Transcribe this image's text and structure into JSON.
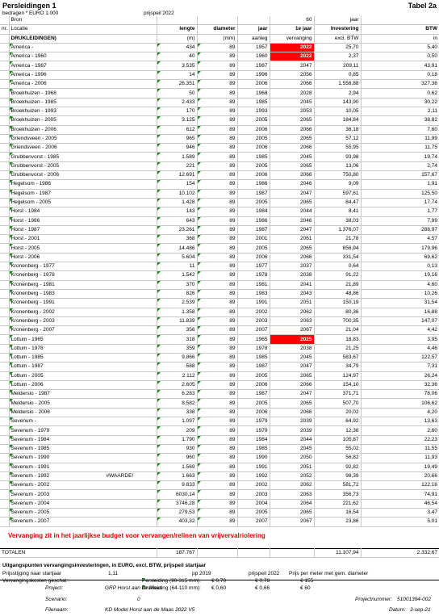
{
  "header": {
    "title": "Persleidingen 1",
    "table_ref": "Tabel 2a",
    "subtitle": "bedragen * EURO 1.000",
    "price_level": "prijspeil 2022"
  },
  "columns": {
    "row1": {
      "col_c": "Bron",
      "col_vervang": "60",
      "col_inv": "jaar"
    },
    "row2": {
      "col_a": "nr.",
      "col_b": "Locatie",
      "lengte": "lengte",
      "diameter": "diameter",
      "jaar": "jaar",
      "vervang": "1e jaar",
      "inv": "Investering",
      "btw": "BTW"
    },
    "row3": {
      "col_b": "DRUKLEIDINGEN)",
      "lengte": "(m)",
      "diameter": "(mm)",
      "jaar": "aanleg",
      "vervang": "vervanging",
      "inv": "excl. BTW",
      "btw": "in"
    }
  },
  "rows": [
    {
      "loc": "America -",
      "len": "434",
      "dia": "89",
      "jaar": "1957",
      "verv": "2022",
      "inv": "25,70",
      "btw": "5,40",
      "red": true
    },
    {
      "loc": "America - 1960",
      "len": "40",
      "dia": "89",
      "jaar": "1960",
      "verv": "2022",
      "inv": "2,37",
      "btw": "0,50",
      "red": true
    },
    {
      "loc": "America - 1987",
      "len": "3.535",
      "dia": "89",
      "jaar": "1987",
      "verv": "2047",
      "inv": "209,11",
      "btw": "43,91"
    },
    {
      "loc": "America - 1996",
      "len": "14",
      "dia": "89",
      "jaar": "1996",
      "verv": "2056",
      "inv": "0,85",
      "btw": "0,18"
    },
    {
      "loc": "America - 2006",
      "len": "26.351",
      "dia": "89",
      "jaar": "2006",
      "verv": "2066",
      "inv": "1.558,88",
      "btw": "327,36"
    },
    {
      "loc": "Broekhuizen - 1968",
      "len": "50",
      "dia": "89",
      "jaar": "1968",
      "verv": "2028",
      "inv": "2,94",
      "btw": "0,62"
    },
    {
      "loc": "Broekhuizen - 1985",
      "len": "2.433",
      "dia": "89",
      "jaar": "1985",
      "verv": "2045",
      "inv": "143,90",
      "btw": "30,22"
    },
    {
      "loc": "Broekhuizen - 1993",
      "len": "170",
      "dia": "89",
      "jaar": "1993",
      "verv": "2053",
      "inv": "10,05",
      "btw": "2,11"
    },
    {
      "loc": "Broekhuizen - 2005",
      "len": "3.125",
      "dia": "89",
      "jaar": "2005",
      "verv": "2065",
      "inv": "184,84",
      "btw": "38,82"
    },
    {
      "loc": "Broekhuizen - 2006",
      "len": "612",
      "dia": "89",
      "jaar": "2006",
      "verv": "2066",
      "inv": "36,18",
      "btw": "7,60"
    },
    {
      "loc": "Griendsveen - 2005",
      "len": "965",
      "dia": "89",
      "jaar": "2005",
      "verv": "2065",
      "inv": "57,12",
      "btw": "11,99"
    },
    {
      "loc": "Griendsveen - 2006",
      "len": "946",
      "dia": "89",
      "jaar": "2006",
      "verv": "2066",
      "inv": "55,95",
      "btw": "11,75"
    },
    {
      "loc": "Grubbenvorst - 1985",
      "len": "1.589",
      "dia": "89",
      "jaar": "1985",
      "verv": "2045",
      "inv": "93,98",
      "btw": "19,74"
    },
    {
      "loc": "Grubbenvorst - 2005",
      "len": "221",
      "dia": "89",
      "jaar": "2005",
      "verv": "2065",
      "inv": "13,06",
      "btw": "2,74"
    },
    {
      "loc": "Grubbenvorst - 2006",
      "len": "12.691",
      "dia": "89",
      "jaar": "2006",
      "verv": "2066",
      "inv": "750,80",
      "btw": "157,67"
    },
    {
      "loc": "Hegelsom - 1986",
      "len": "154",
      "dia": "89",
      "jaar": "1986",
      "verv": "2046",
      "inv": "9,09",
      "btw": "1,91"
    },
    {
      "loc": "Hegelsom - 1987",
      "len": "10.102",
      "dia": "89",
      "jaar": "1987",
      "verv": "2047",
      "inv": "597,61",
      "btw": "125,50"
    },
    {
      "loc": "Hegelsom - 2005",
      "len": "1.428",
      "dia": "89",
      "jaar": "2005",
      "verv": "2065",
      "inv": "84,47",
      "btw": "17,74"
    },
    {
      "loc": "Horst - 1984",
      "len": "143",
      "dia": "89",
      "jaar": "1984",
      "verv": "2044",
      "inv": "8,41",
      "btw": "1,77"
    },
    {
      "loc": "Horst - 1986",
      "len": "643",
      "dia": "89",
      "jaar": "1986",
      "verv": "2046",
      "inv": "38,03",
      "btw": "7,99"
    },
    {
      "loc": "Horst - 1987",
      "len": "23.261",
      "dia": "89",
      "jaar": "1987",
      "verv": "2047",
      "inv": "1.376,07",
      "btw": "288,97"
    },
    {
      "loc": "Horst - 2001",
      "len": "368",
      "dia": "89",
      "jaar": "2001",
      "verv": "2061",
      "inv": "21,78",
      "btw": "4,57"
    },
    {
      "loc": "Horst - 2005",
      "len": "14.486",
      "dia": "89",
      "jaar": "2005",
      "verv": "2065",
      "inv": "856,94",
      "btw": "179,96"
    },
    {
      "loc": "Horst - 2006",
      "len": "5.604",
      "dia": "89",
      "jaar": "2006",
      "verv": "2066",
      "inv": "331,54",
      "btw": "69,62"
    },
    {
      "loc": "Kronenberg - 1977",
      "len": "11",
      "dia": "89",
      "jaar": "1977",
      "verv": "2037",
      "inv": "0,64",
      "btw": "0,13"
    },
    {
      "loc": "Kronenberg - 1978",
      "len": "1.542",
      "dia": "89",
      "jaar": "1978",
      "verv": "2038",
      "inv": "91,22",
      "btw": "19,16"
    },
    {
      "loc": "Kronenberg - 1981",
      "len": "370",
      "dia": "89",
      "jaar": "1981",
      "verv": "2041",
      "inv": "21,89",
      "btw": "4,60"
    },
    {
      "loc": "Kronenberg - 1983",
      "len": "826",
      "dia": "89",
      "jaar": "1983",
      "verv": "2043",
      "inv": "48,86",
      "btw": "10,26"
    },
    {
      "loc": "Kronenberg - 1991",
      "len": "2.539",
      "dia": "89",
      "jaar": "1991",
      "verv": "2051",
      "inv": "150,19",
      "btw": "31,54"
    },
    {
      "loc": "Kronenberg - 2002",
      "len": "1.358",
      "dia": "89",
      "jaar": "2002",
      "verv": "2062",
      "inv": "80,36",
      "btw": "16,88"
    },
    {
      "loc": "Kronenberg - 2003",
      "len": "11.839",
      "dia": "89",
      "jaar": "2003",
      "verv": "2063",
      "inv": "700,35",
      "btw": "147,07"
    },
    {
      "loc": "Kronenberg - 2007",
      "len": "356",
      "dia": "89",
      "jaar": "2007",
      "verv": "2067",
      "inv": "21,04",
      "btw": "4,42"
    },
    {
      "loc": "Lottum - 1965",
      "len": "318",
      "dia": "89",
      "jaar": "1965",
      "verv": "2025",
      "inv": "18,83",
      "btw": "3,95",
      "red": true
    },
    {
      "loc": "Lottum - 1978",
      "len": "359",
      "dia": "89",
      "jaar": "1978",
      "verv": "2038",
      "inv": "21,25",
      "btw": "4,46"
    },
    {
      "loc": "Lottum - 1985",
      "len": "9.866",
      "dia": "89",
      "jaar": "1985",
      "verv": "2045",
      "inv": "583,67",
      "btw": "122,57"
    },
    {
      "loc": "Lottum - 1987",
      "len": "588",
      "dia": "89",
      "jaar": "1987",
      "verv": "2047",
      "inv": "34,79",
      "btw": "7,31"
    },
    {
      "loc": "Lottum - 2005",
      "len": "2.112",
      "dia": "89",
      "jaar": "2005",
      "verv": "2065",
      "inv": "124,97",
      "btw": "26,24"
    },
    {
      "loc": "Lottum - 2006",
      "len": "2.605",
      "dia": "89",
      "jaar": "2006",
      "verv": "2066",
      "inv": "154,10",
      "btw": "32,36"
    },
    {
      "loc": "Meldersio - 1987",
      "len": "6.283",
      "dia": "89",
      "jaar": "1987",
      "verv": "2047",
      "inv": "371,71",
      "btw": "78,06"
    },
    {
      "loc": "Meldersio - 2005",
      "len": "8.582",
      "dia": "89",
      "jaar": "2005",
      "verv": "2065",
      "inv": "507,70",
      "btw": "106,62"
    },
    {
      "loc": "Meldersio - 2006",
      "len": "338",
      "dia": "89",
      "jaar": "2006",
      "verv": "2066",
      "inv": "20,02",
      "btw": "4,20"
    },
    {
      "loc": "Sevenum -",
      "len": "1.097",
      "dia": "89",
      "jaar": "1979",
      "verv": "2039",
      "inv": "64,92",
      "btw": "13,63"
    },
    {
      "loc": "Sevenum - 1979",
      "len": "209",
      "dia": "89",
      "jaar": "1979",
      "verv": "2039",
      "inv": "12,36",
      "btw": "2,60"
    },
    {
      "loc": "Sevenum - 1984",
      "len": "1.790",
      "dia": "89",
      "jaar": "1984",
      "verv": "2044",
      "inv": "105,87",
      "btw": "22,23"
    },
    {
      "loc": "Sevenum - 1985",
      "len": "930",
      "dia": "89",
      "jaar": "1985",
      "verv": "2045",
      "inv": "55,02",
      "btw": "11,55"
    },
    {
      "loc": "Sevenum - 1990",
      "len": "960",
      "dia": "89",
      "jaar": "1990",
      "verv": "2050",
      "inv": "56,82",
      "btw": "11,93"
    },
    {
      "loc": "Sevenum - 1991",
      "len": "1.569",
      "dia": "89",
      "jaar": "1991",
      "verv": "2051",
      "inv": "92,82",
      "btw": "19,49"
    },
    {
      "loc": "Sevenum - 1992",
      "len": "1.663",
      "dia": "89",
      "jaar": "1992",
      "verv": "2052",
      "inv": "98,39",
      "btw": "20,66",
      "extra": "#WAARDE!"
    },
    {
      "loc": "Sevenum - 2002",
      "len": "9.833",
      "dia": "89",
      "jaar": "2002",
      "verv": "2062",
      "inv": "581,72",
      "btw": "122,16"
    },
    {
      "loc": "Sevenum - 2003",
      "len": "6030,14",
      "dia": "89",
      "jaar": "2003",
      "verv": "2063",
      "inv": "356,73",
      "btw": "74,91"
    },
    {
      "loc": "Sevenum - 2004",
      "len": "3746,28",
      "dia": "89",
      "jaar": "2004",
      "verv": "2064",
      "inv": "221,62",
      "btw": "46,54"
    },
    {
      "loc": "Sevenum - 2005",
      "len": "279,53",
      "dia": "89",
      "jaar": "2005",
      "verv": "2065",
      "inv": "16,54",
      "btw": "3,47"
    },
    {
      "loc": "Sevenum - 2007",
      "len": "403,32",
      "dia": "89",
      "jaar": "2007",
      "verv": "2067",
      "inv": "23,86",
      "btw": "5,01"
    }
  ],
  "note": "Vervanging zit in het jaarlijkse budget voor vervangen/relinen van vrijvervalriolering",
  "totals": {
    "label": "TOTALEN",
    "len": "187.767",
    "inv": "11.107,94",
    "btw": "2.332,67"
  },
  "units": {
    "title": "Uitgangspunten vervangingsinvesteringen, in EURO, excl. BTW, prijspeil startjaar",
    "indexation_label": "Prijsstijging naar startjaar",
    "indexation_value": "1,11",
    "costs_label": "Vervangingskosten geschat :",
    "pp2019": "pp 2019",
    "pp2022": "prijspeil 2022",
    "price_per_meter": "Prijs per meter met gem. diameter",
    "pers_label": "Persleiding (90-315 mm):",
    "pers_2019": "€ 0,70",
    "pers_2022": "€ 0,78",
    "pers_pm": "€ 155",
    "druk_label": "Drukleiding (64-110 mm):",
    "druk_2019": "€ 0,60",
    "druk_2022": "€ 0,66",
    "druk_pm": "€ 60"
  },
  "footer": {
    "project_label": "Project:",
    "project_value": "GRP Horst aan de Maas",
    "scenario_label": "Scenario:",
    "scenario_value": "0",
    "filename_label": "Filenaam:",
    "filename_value": "KD Model Horst aan de Maas 2022 V5",
    "projectnr_label": "Projectnummer:",
    "projectnr_value": "51001394-002",
    "datum_label": "Datum:",
    "datum_value": "3-sep-21"
  },
  "colors": {
    "highlight_red": "#ff0000",
    "note_red": "#e00000",
    "marker_green": "#1a8c1a"
  }
}
